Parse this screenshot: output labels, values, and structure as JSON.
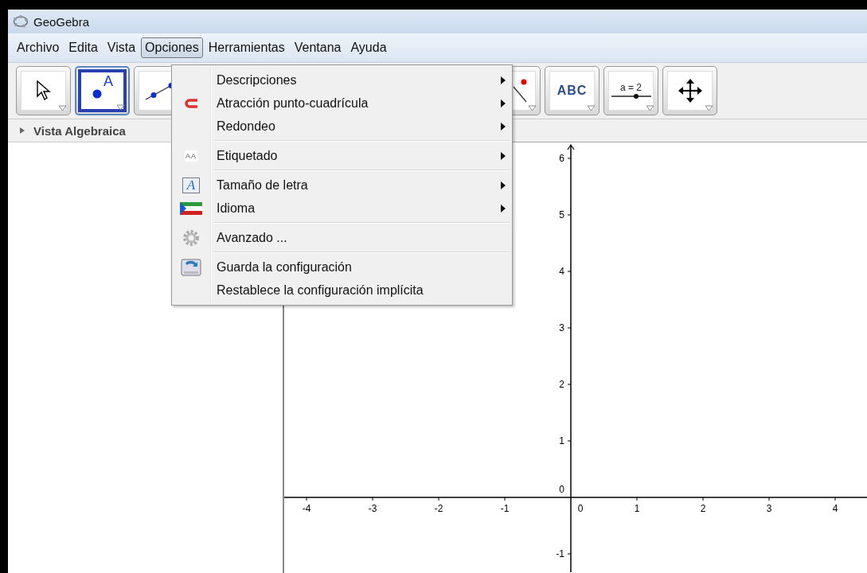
{
  "window": {
    "title": "GeoGebra"
  },
  "menu_bar": [
    {
      "label": "Archivo",
      "selected": false
    },
    {
      "label": "Edita",
      "selected": false
    },
    {
      "label": "Vista",
      "selected": false
    },
    {
      "label": "Opciones",
      "selected": true
    },
    {
      "label": "Herramientas",
      "selected": false
    },
    {
      "label": "Ventana",
      "selected": false
    },
    {
      "label": "Ayuda",
      "selected": false
    }
  ],
  "toolbar": {
    "left": [
      {
        "kind": "pointer",
        "selected": false
      },
      {
        "kind": "point",
        "selected": true,
        "label": "A"
      },
      {
        "kind": "line",
        "selected": false
      }
    ],
    "right": [
      {
        "kind": "point-line",
        "selected": false
      },
      {
        "kind": "text",
        "selected": false,
        "label": "ABC"
      },
      {
        "kind": "slider",
        "selected": false,
        "label": "a = 2"
      },
      {
        "kind": "move",
        "selected": false
      }
    ]
  },
  "algebra_view": {
    "title": "Vista Algebraica",
    "expanded": false
  },
  "options_menu": {
    "groups": [
      [
        {
          "label": "Descripciones",
          "submenu": true
        },
        {
          "label": "Atracción punto-cuadrícula",
          "submenu": true
        },
        {
          "label": "Redondeo",
          "submenu": true
        }
      ],
      [
        {
          "label": "Etiquetado",
          "submenu": true,
          "icon_text": "AA"
        }
      ],
      [
        {
          "label": "Tamaño de letra",
          "submenu": true,
          "icon_text": "A"
        },
        {
          "label": "Idioma",
          "submenu": true
        }
      ],
      [
        {
          "label": "Avanzado ...",
          "submenu": false
        }
      ],
      [
        {
          "label": "Guarda la configuración",
          "submenu": false
        },
        {
          "label": "Restablece la configuración implícita",
          "submenu": false
        }
      ]
    ]
  },
  "graphics": {
    "x_labels": [
      "-4",
      "-3",
      "-2",
      "-1",
      "0",
      "1",
      "2",
      "3",
      "4"
    ],
    "y_labels": [
      "6",
      "5",
      "4",
      "3",
      "2",
      "1",
      "0",
      "-1"
    ]
  }
}
